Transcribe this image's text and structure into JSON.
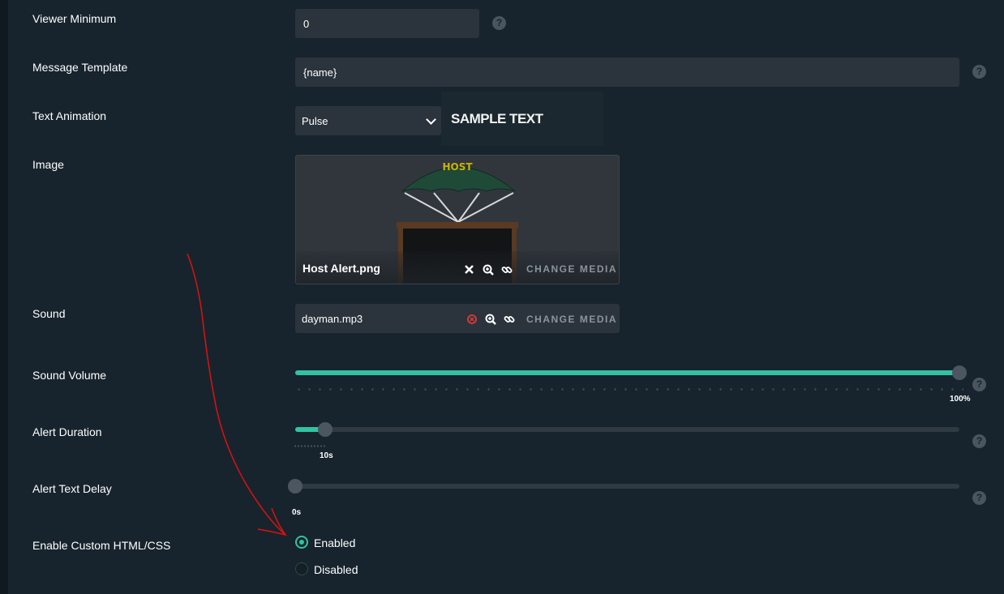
{
  "form": {
    "viewer_minimum": {
      "label": "Viewer Minimum",
      "value": "0"
    },
    "message_template": {
      "label": "Message Template",
      "value": "{name}"
    },
    "text_animation": {
      "label": "Text Animation",
      "selected": "Pulse",
      "sample_text": "SAMPLE TEXT"
    },
    "image": {
      "label": "Image",
      "filename": "Host Alert.png",
      "change_media": "CHANGE MEDIA",
      "preview_text": "HOST"
    },
    "sound": {
      "label": "Sound",
      "filename": "dayman.mp3",
      "change_media": "CHANGE MEDIA"
    },
    "sound_volume": {
      "label": "Sound Volume",
      "value_text": "100%",
      "fraction": 1.0
    },
    "alert_duration": {
      "label": "Alert Duration",
      "value_text": "10s",
      "fraction": 0.045
    },
    "alert_text_delay": {
      "label": "Alert Text Delay",
      "value_text": "0s",
      "fraction": 0.0
    },
    "custom_html": {
      "label": "Enable Custom HTML/CSS",
      "options": [
        "Enabled",
        "Disabled"
      ],
      "selected": "Enabled"
    }
  },
  "help_glyph": "?",
  "colors": {
    "accent": "#31c3a2",
    "background": "#17242d",
    "field": "#2b343c",
    "annotation": "#e01010"
  },
  "icons": {
    "remove": "close-icon",
    "zoom": "zoom-icon",
    "link": "link-icon"
  }
}
